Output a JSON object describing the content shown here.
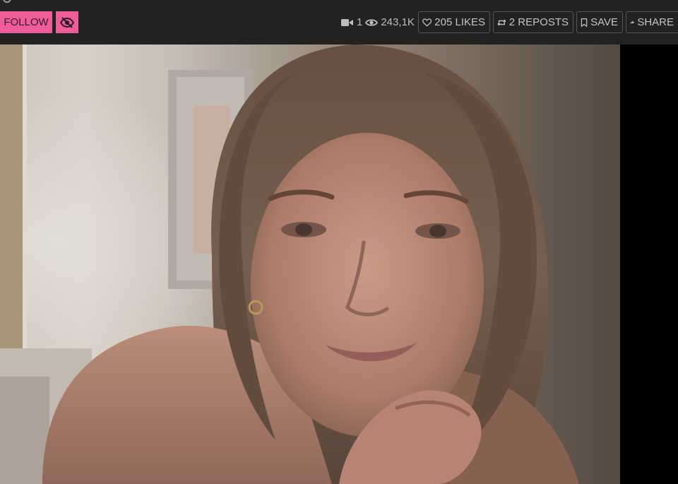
{
  "header": {
    "follow_label": "FOLLOW",
    "stats": {
      "video_count": "1",
      "views": "243,1K"
    },
    "actions": {
      "likes_label": "205 LIKES",
      "reposts_label": "2 REPOSTS",
      "save_label": "SAVE",
      "share_label": "SHARE"
    }
  },
  "icons": {
    "hide": "eye-slash-icon",
    "video": "video-camera-icon",
    "views": "eye-icon",
    "likes": "heart-icon",
    "reposts": "repost-icon",
    "save": "bookmark-icon",
    "share": "share-arrow-icon"
  },
  "colors": {
    "accent": "#ee5c9b",
    "header_bg": "#222222",
    "border": "#555555"
  }
}
